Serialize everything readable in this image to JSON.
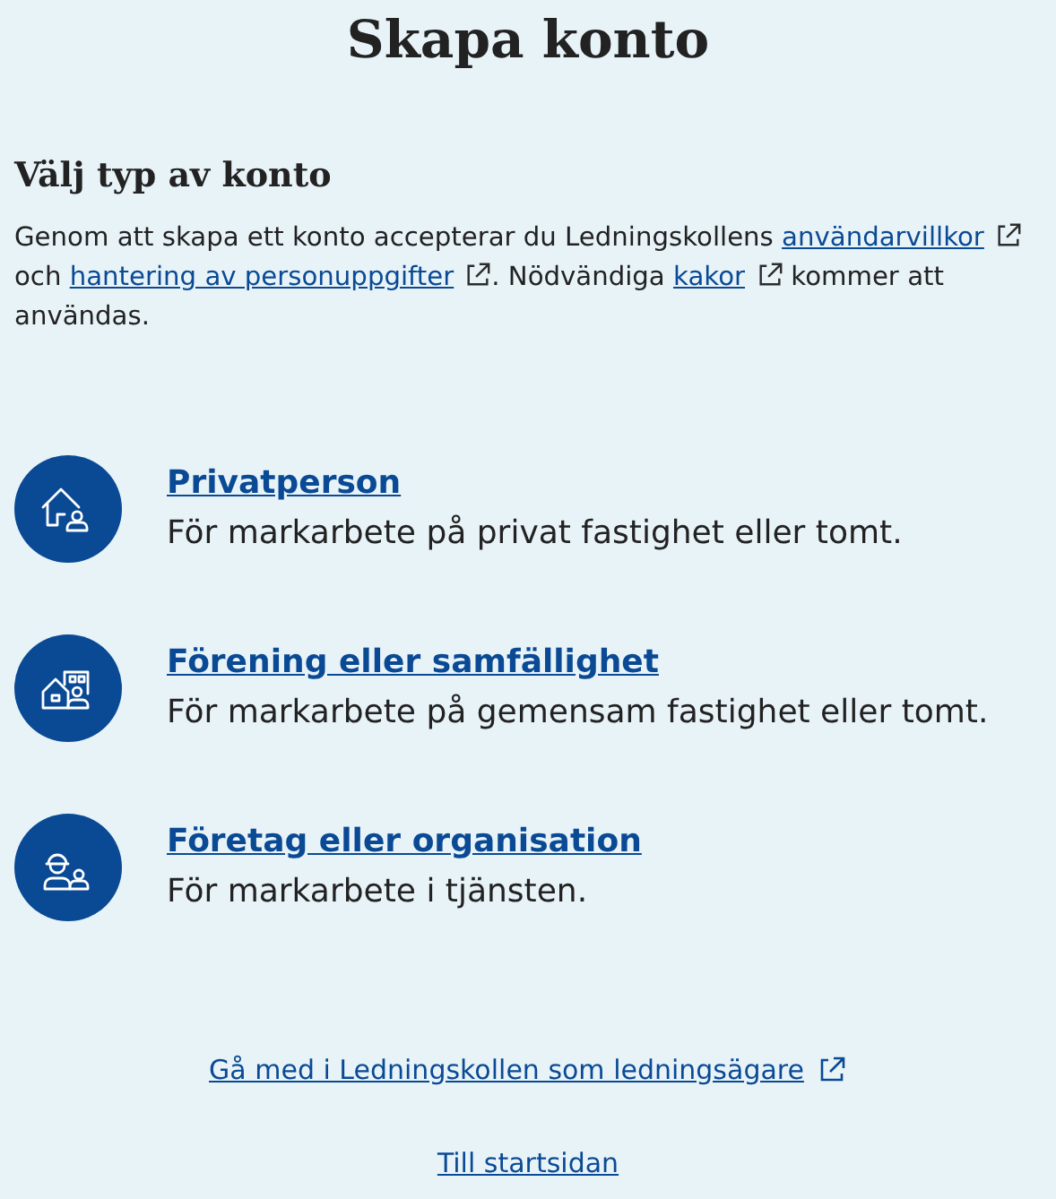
{
  "title": "Skapa konto",
  "section": {
    "heading": "Välj typ av konto",
    "terms": [
      {
        "kind": "text",
        "text": "Genom att skapa ett konto accepterar du Ledningskollens "
      },
      {
        "kind": "link",
        "text": "användarvillkor"
      },
      {
        "kind": "text",
        "text": " och "
      },
      {
        "kind": "link",
        "text": "hantering av personuppgifter"
      },
      {
        "kind": "text",
        "text": ". Nödvändiga "
      },
      {
        "kind": "link",
        "text": "kakor"
      },
      {
        "kind": "text",
        "text": " kommer att användas."
      }
    ]
  },
  "options": [
    {
      "kind": "private",
      "title": "Privatperson",
      "description": "För markarbete på privat fastighet eller tomt."
    },
    {
      "kind": "association",
      "title": "Förening eller samfällighet",
      "description": "För markarbete på gemensam fastighet eller tomt."
    },
    {
      "kind": "company",
      "title": "Företag eller organisation",
      "description": "För markarbete i tjänsten."
    }
  ],
  "footer_links": [
    {
      "text": "Gå med i Ledningskollen som ledningsägare",
      "external": true
    },
    {
      "text": "Till startsidan",
      "external": false
    }
  ]
}
